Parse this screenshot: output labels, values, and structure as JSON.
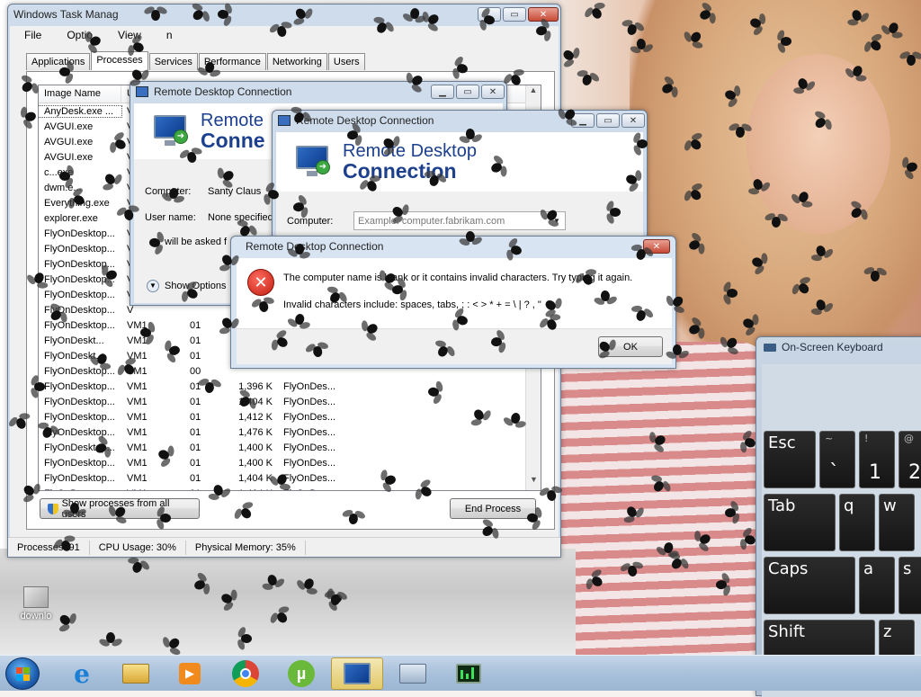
{
  "desktop": {
    "icon_label": "downlo"
  },
  "taskmgr": {
    "title": "Windows Task Manag",
    "menu": [
      "File",
      "Optio",
      "View",
      "n"
    ],
    "tabs": [
      "Applications",
      "Processes",
      "Services",
      "Performance",
      "Networking",
      "Users"
    ],
    "active_tab": "Processes",
    "columns": [
      "Image Name",
      "U"
    ],
    "rows": [
      {
        "name": "AnyDesk.exe ...",
        "user": "V",
        "cpu": "",
        "mem": "",
        "desc": ""
      },
      {
        "name": "AVGUI.exe",
        "user": "V",
        "cpu": "",
        "mem": "",
        "desc": ""
      },
      {
        "name": "AVGUI.exe",
        "user": "V",
        "cpu": "",
        "mem": "",
        "desc": ""
      },
      {
        "name": "AVGUI.exe",
        "user": "V",
        "cpu": "",
        "mem": "",
        "desc": ""
      },
      {
        "name": "c...exe",
        "user": "V",
        "cpu": "",
        "mem": "",
        "desc": ""
      },
      {
        "name": "dwm.e...",
        "user": "V",
        "cpu": "",
        "mem": "",
        "desc": ""
      },
      {
        "name": "Everything.exe",
        "user": "V",
        "cpu": "",
        "mem": "",
        "desc": ""
      },
      {
        "name": "explorer.exe",
        "user": "V",
        "cpu": "",
        "mem": "",
        "desc": ""
      },
      {
        "name": "FlyOnDesktop...",
        "user": "V",
        "cpu": "",
        "mem": "",
        "desc": ""
      },
      {
        "name": "FlyOnDesktop...",
        "user": "V",
        "cpu": "",
        "mem": "",
        "desc": ""
      },
      {
        "name": "FlyOnDesktop...",
        "user": "V",
        "cpu": "",
        "mem": "",
        "desc": ""
      },
      {
        "name": "FlyOnDesktop...",
        "user": "V",
        "cpu": "",
        "mem": "",
        "desc": ""
      },
      {
        "name": "FlyOnDesktop...",
        "user": "V",
        "cpu": "",
        "mem": "",
        "desc": ""
      },
      {
        "name": "FlyOnDesktop...",
        "user": "V",
        "cpu": "",
        "mem": "",
        "desc": ""
      },
      {
        "name": "FlyOnDesktop...",
        "user": "VM1",
        "cpu": "01",
        "mem": "",
        "desc": ""
      },
      {
        "name": "FlyOnDeskt...",
        "user": "VM1",
        "cpu": "01",
        "mem": "",
        "desc": ""
      },
      {
        "name": "FlyOnDeskt...",
        "user": "VM1",
        "cpu": "01",
        "mem": "",
        "desc": ""
      },
      {
        "name": "FlyOnDesktop...",
        "user": "VM1",
        "cpu": "00",
        "mem": "",
        "desc": ""
      },
      {
        "name": "FlyOnDesktop...",
        "user": "VM1",
        "cpu": "01",
        "mem": "1,396 K",
        "desc": "FlyOnDes..."
      },
      {
        "name": "FlyOnDesktop...",
        "user": "VM1",
        "cpu": "01",
        "mem": "1,404 K",
        "desc": "FlyOnDes..."
      },
      {
        "name": "FlyOnDesktop...",
        "user": "VM1",
        "cpu": "01",
        "mem": "1,412 K",
        "desc": "FlyOnDes..."
      },
      {
        "name": "FlyOnDesktop...",
        "user": "VM1",
        "cpu": "01",
        "mem": "1,476 K",
        "desc": "FlyOnDes..."
      },
      {
        "name": "FlyOnDesktop...",
        "user": "VM1",
        "cpu": "01",
        "mem": "1,400 K",
        "desc": "FlyOnDes..."
      },
      {
        "name": "FlyOnDesktop...",
        "user": "VM1",
        "cpu": "01",
        "mem": "1,400 K",
        "desc": "FlyOnDes..."
      },
      {
        "name": "FlyOnDesktop...",
        "user": "VM1",
        "cpu": "01",
        "mem": "1,404 K",
        "desc": "FlyOnDes..."
      },
      {
        "name": "FlyOnDes...",
        "user": "VM1",
        "cpu": "01",
        "mem": "1,404 K",
        "desc": "FlyOnDes..."
      }
    ],
    "show_all_label": "Show processes from all users",
    "end_process_label": "End Process",
    "status": {
      "processes": "Processes: 91",
      "cpu": "CPU Usage: 30%",
      "memory": "Physical Memory: 35%"
    }
  },
  "rdc_back": {
    "title": "Remote Desktop Connection",
    "banner_line1": "Remote",
    "banner_line2": "Conne",
    "computer_label": "Computer:",
    "computer_value": "Santy Claus",
    "user_label": "User name:",
    "user_value": "None specified",
    "note": "will be asked f",
    "options_label": "Show Options"
  },
  "rdc_front": {
    "title": "Remote Desktop Connection",
    "banner_line1": "Remote Desktop",
    "banner_line2": "Connection",
    "computer_label": "Computer:",
    "computer_placeholder": "Example: computer.fabrikam.com"
  },
  "error_dialog": {
    "title": "Remote Desktop Connection",
    "message": "The computer name is blank or it contains invalid characters. Try typing it again.",
    "detail": "Invalid characters include: spaces, tabs, ; : < > * + = \\ | ? ,  \"",
    "ok_label": "OK"
  },
  "osk": {
    "title": "On-Screen Keyboard",
    "rows": [
      [
        {
          "label": "Esc"
        },
        {
          "top": "~",
          "main": "`"
        },
        {
          "top": "!",
          "main": "1"
        },
        {
          "top": "@",
          "main": "2"
        }
      ],
      [
        {
          "label": "Tab"
        },
        {
          "main": "q"
        },
        {
          "main": "w"
        }
      ],
      [
        {
          "label": "Caps"
        },
        {
          "main": "a"
        },
        {
          "main": "s"
        }
      ],
      [
        {
          "label": "Shift"
        },
        {
          "main": "z"
        }
      ]
    ]
  },
  "taskbar": {
    "items": [
      "internet-explorer",
      "file-explorer",
      "media-player",
      "chrome",
      "utorrent",
      "remote-desktop",
      "network-computer",
      "task-manager"
    ],
    "active": "remote-desktop"
  }
}
